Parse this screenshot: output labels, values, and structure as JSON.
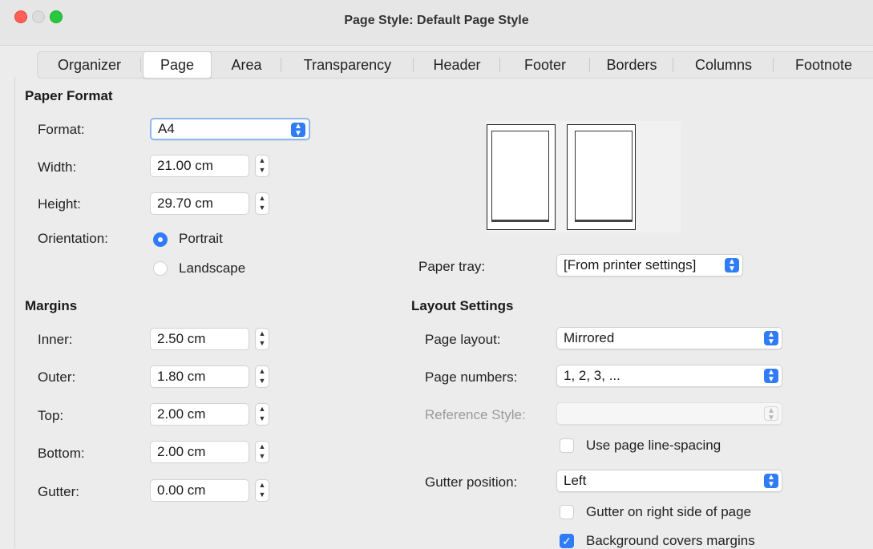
{
  "window": {
    "title": "Page Style: Default Page Style"
  },
  "tabs": [
    "Organizer",
    "Page",
    "Area",
    "Transparency",
    "Header",
    "Footer",
    "Borders",
    "Columns",
    "Footnote"
  ],
  "paper_format": {
    "heading": "Paper Format",
    "format_label": "Format:",
    "format_value": "A4",
    "width_label": "Width:",
    "width_value": "21.00 cm",
    "height_label": "Height:",
    "height_value": "29.70 cm",
    "orientation_label": "Orientation:",
    "portrait_label": "Portrait",
    "landscape_label": "Landscape",
    "orientation_selected": "Portrait"
  },
  "paper_tray": {
    "label": "Paper tray:",
    "value": "[From printer settings]"
  },
  "margins": {
    "heading": "Margins",
    "inner_label": "Inner:",
    "inner_value": "2.50 cm",
    "outer_label": "Outer:",
    "outer_value": "1.80 cm",
    "top_label": "Top:",
    "top_value": "2.00 cm",
    "bottom_label": "Bottom:",
    "bottom_value": "2.00 cm",
    "gutter_label": "Gutter:",
    "gutter_value": "0.00 cm"
  },
  "layout_settings": {
    "heading": "Layout Settings",
    "page_layout_label": "Page layout:",
    "page_layout_value": "Mirrored",
    "page_numbers_label": "Page numbers:",
    "page_numbers_value": "1, 2, 3, ...",
    "reference_style_label": "Reference Style:",
    "reference_style_value": "",
    "use_line_spacing_label": "Use page line-spacing",
    "use_line_spacing_checked": false,
    "gutter_position_label": "Gutter position:",
    "gutter_position_value": "Left",
    "gutter_right_label": "Gutter on right side of page",
    "gutter_right_checked": false,
    "background_margins_label": "Background covers margins",
    "background_margins_checked": true
  },
  "colors": {
    "accent": "#2f7cf6",
    "close": "#ff5f57",
    "maximize": "#28c840"
  }
}
